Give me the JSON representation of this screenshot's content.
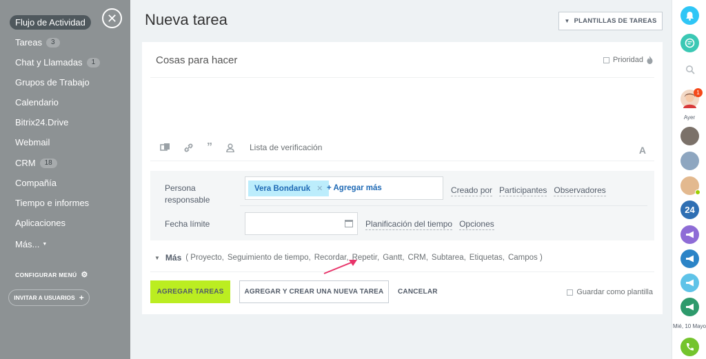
{
  "sidebar": {
    "active_item": "Flujo de Actividad",
    "items": [
      {
        "label": "Tareas",
        "count": "3"
      },
      {
        "label": "Chat y Llamadas",
        "count": "1"
      },
      {
        "label": "Grupos de Trabajo",
        "count": ""
      },
      {
        "label": "Calendario",
        "count": ""
      },
      {
        "label": "Bitrix24.Drive",
        "count": ""
      },
      {
        "label": "Webmail",
        "count": ""
      },
      {
        "label": "CRM",
        "count": "18"
      },
      {
        "label": "Compañía",
        "count": ""
      },
      {
        "label": "Tiempo e informes",
        "count": ""
      },
      {
        "label": "Aplicaciones",
        "count": ""
      }
    ],
    "more_label": "Más...",
    "configure_menu": "CONFIGURAR MENÚ",
    "invite_users": "INVITAR A USUARIOS"
  },
  "header": {
    "title": "Nueva tarea",
    "templates_button": "PLANTILLAS DE TAREAS"
  },
  "task": {
    "title_placeholder": "Cosas para hacer",
    "priority_label": "Prioridad",
    "checklist_label": "Lista de verificación",
    "responsible_label_line1": "Persona",
    "responsible_label_line2": "responsable",
    "responsible_user": "Vera Bondaruk",
    "add_more": "+ Agregar más",
    "role_links": [
      "Creado por",
      "Participantes",
      "Observadores"
    ],
    "deadline_label": "Fecha límite",
    "deadline_links": [
      "Planificación del tiempo",
      "Opciones"
    ],
    "more_label": "Más",
    "more_options": [
      "( Proyecto,",
      "Seguimiento de tiempo,",
      "Recordar,",
      "Repetir,",
      "Gantt,",
      "CRM,",
      "Subtarea,",
      "Etiquetas,",
      "Campos )"
    ]
  },
  "actions": {
    "add_task": "AGREGAR TAREAS",
    "add_and_new": "AGREGAR Y CREAR UNA NUEVA TAREA",
    "cancel": "CANCELAR",
    "save_template": "Guardar como plantilla"
  },
  "rightbar": {
    "notification_count": "1",
    "yesterday_label": "Ayer",
    "bitrix_label": "24",
    "date_label": "Mié, 10 Mayo"
  },
  "colors": {
    "accent_green": "#bbed21",
    "link_blue": "#1f6ab5",
    "arrow_pink": "#e8346a"
  }
}
